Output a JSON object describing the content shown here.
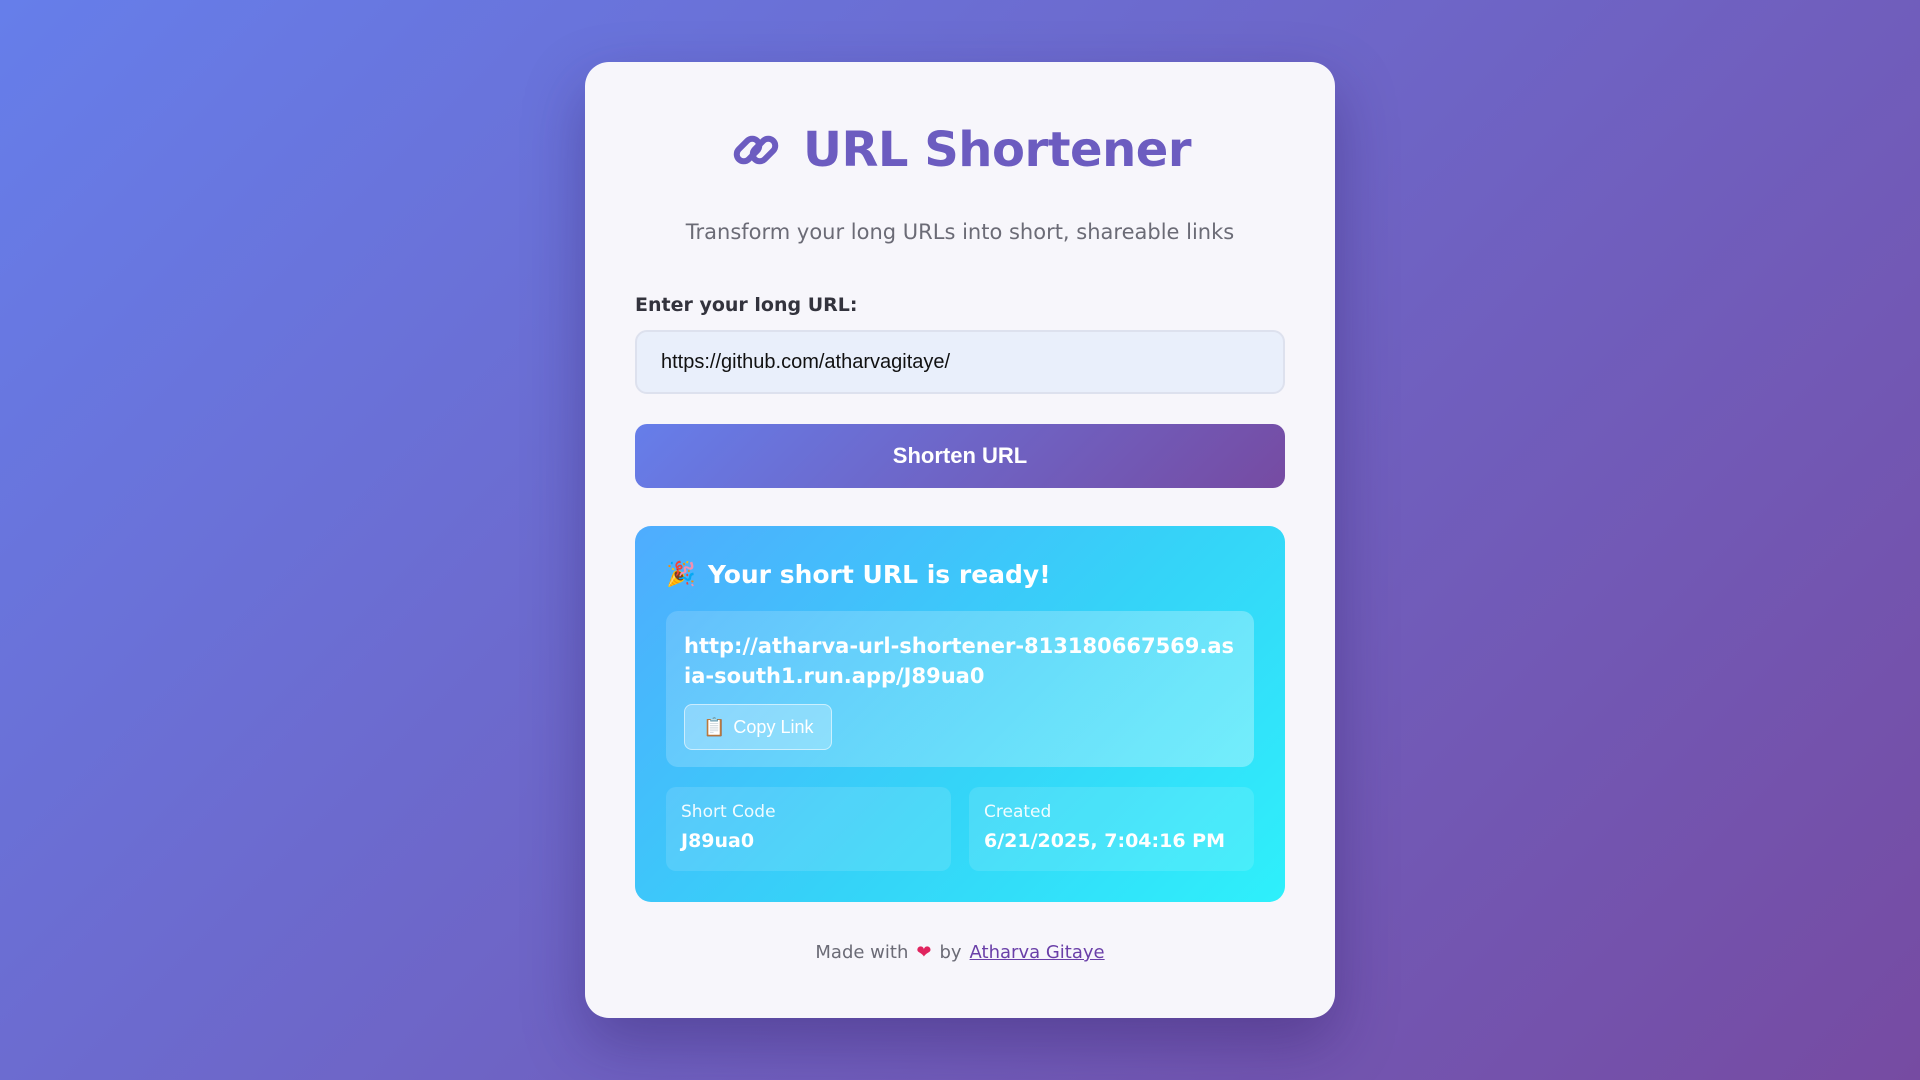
{
  "header": {
    "icon": "link-icon",
    "title": "URL Shortener",
    "subtitle": "Transform your long URLs into short, shareable links"
  },
  "form": {
    "label": "Enter your long URL:",
    "input_value": "https://github.com/atharvagitaye/",
    "submit_label": "Shorten URL"
  },
  "result": {
    "icon": "party-popper-icon",
    "title": "Your short URL is ready!",
    "short_url": "http://atharva-url-shortener-813180667569.asia-south1.run.app/J89ua0",
    "copy_icon": "clipboard-icon",
    "copy_label": "Copy Link",
    "short_code_label": "Short Code",
    "short_code_value": "J89ua0",
    "created_label": "Created",
    "created_value": "6/21/2025, 7:04:16 PM"
  },
  "footer": {
    "prefix": "Made with",
    "heart_icon": "heart-icon",
    "by": "by",
    "author": "Atharva Gitaye"
  },
  "colors": {
    "bg_start": "#667eea",
    "bg_end": "#764ba2",
    "title": "#6c5cc0",
    "result_start": "#4facfe",
    "result_end": "#2ef0fb"
  }
}
